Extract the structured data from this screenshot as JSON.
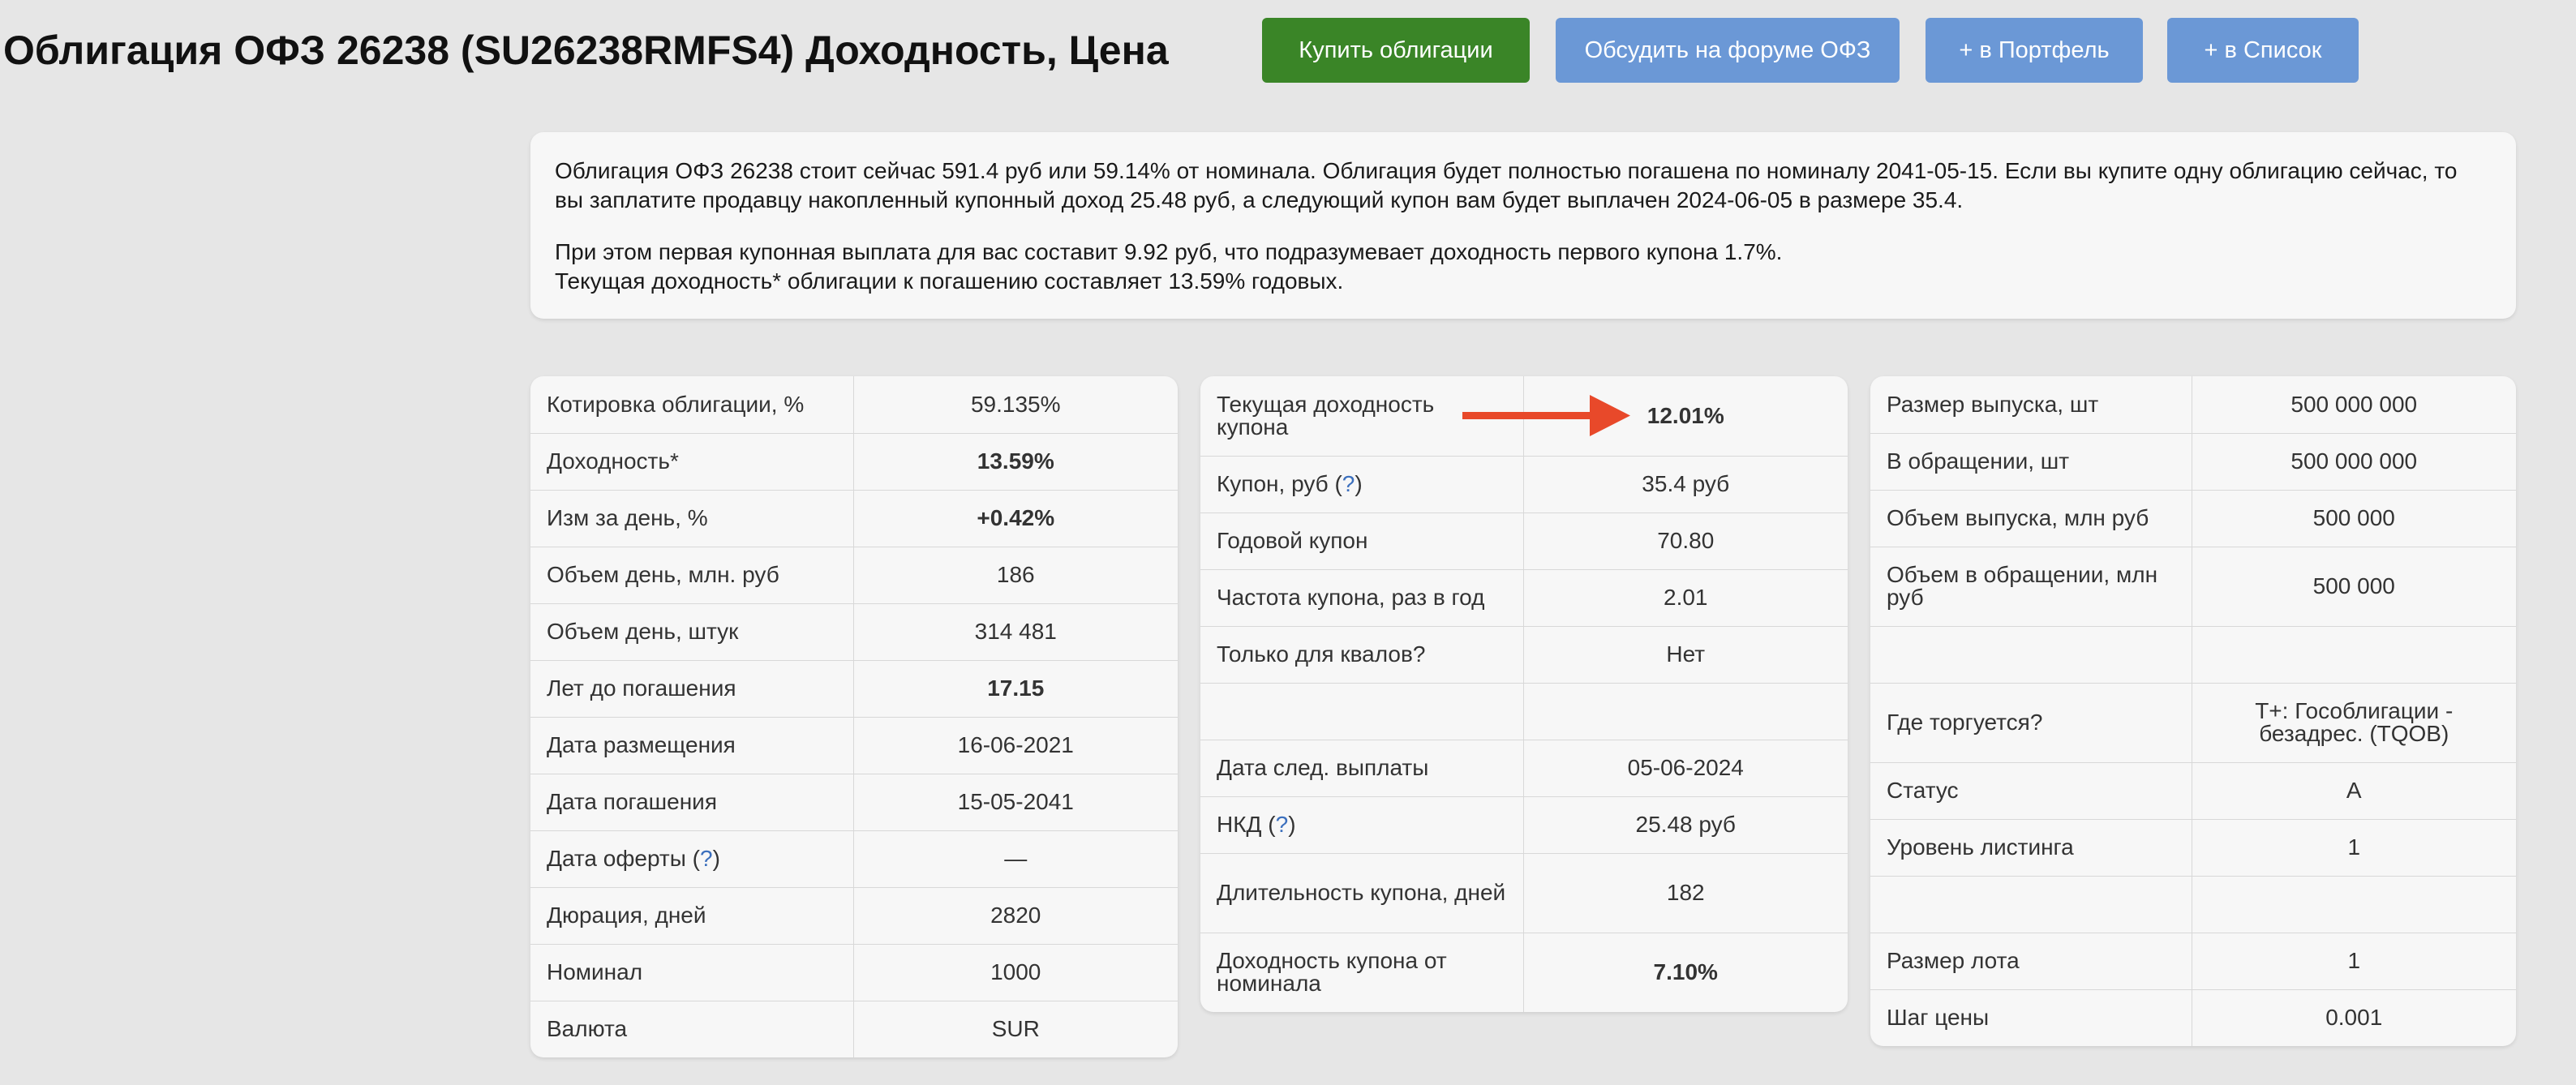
{
  "header": {
    "title": "Облигация ОФЗ 26238 (SU26238RMFS4) Доходность, Цена",
    "buttons": {
      "buy": "Купить облигации",
      "forum": "Обсудить на форуме ОФЗ",
      "portfolio": "+ в Портфель",
      "list": "+ в Список"
    }
  },
  "description": {
    "p1": "Облигация ОФЗ 26238 стоит сейчас 591.4 руб или 59.14% от номинала. Облигация будет полностью погашена по номиналу 2041-05-15. Если вы купите одну облигацию сейчас, то вы заплатите продавцу накопленный купонный доход 25.48 руб, а следующий купон вам будет выплачен 2024-06-05 в размере 35.4.",
    "p2_line1": "При этом первая купонная выплата для вас составит 9.92 руб, что подразумевает доходность первого купона 1.7%.",
    "p2_line2": "Текущая доходность* облигации к погашению составляет 13.59% годовых."
  },
  "tables": {
    "left": [
      {
        "label": "Котировка облигации, %",
        "value": "59.135%"
      },
      {
        "label": "Доходность*",
        "value": "13.59%"
      },
      {
        "label": "Изм за день, %",
        "value": "+0.42%"
      },
      {
        "label": "Объем день, млн. руб",
        "value": "186"
      },
      {
        "label": "Объем день, штук",
        "value": "314 481"
      },
      {
        "label": "Лет до погашения",
        "value": "17.15"
      },
      {
        "label": "Дата размещения",
        "value": "16-06-2021"
      },
      {
        "label": "Дата погашения",
        "value": "15-05-2041"
      },
      {
        "label": "Дата оферты (",
        "help": "?",
        "label_end": ")",
        "value": "—"
      },
      {
        "label": "Дюрация, дней",
        "value": "2820"
      },
      {
        "label": "Номинал",
        "value": "1000"
      },
      {
        "label": "Валюта",
        "value": "SUR"
      }
    ],
    "middle": [
      {
        "label": "Текущая доходность купона",
        "value": "12.01%"
      },
      {
        "label": "Купон, руб (",
        "help": "?",
        "label_end": ")",
        "value": "35.4 руб"
      },
      {
        "label": "Годовой купон",
        "value": "70.80"
      },
      {
        "label": "Частота купона, раз в год",
        "value": "2.01"
      },
      {
        "label": "Только для квалов?",
        "value": "Нет"
      },
      {
        "label": "",
        "value": ""
      },
      {
        "label": "Дата след. выплаты",
        "value": "05-06-2024"
      },
      {
        "label": "НКД (",
        "help": "?",
        "label_end": ")",
        "value": "25.48 руб"
      },
      {
        "label": "Длительность купона, дней",
        "value": "182"
      },
      {
        "label": "Доходность купона от номинала",
        "value": "7.10%"
      }
    ],
    "right": [
      {
        "label": "Размер выпуска, шт",
        "value": "500 000 000"
      },
      {
        "label": "В обращении, шт",
        "value": "500 000 000"
      },
      {
        "label": "Объем выпуска, млн руб",
        "value": "500 000"
      },
      {
        "label": "Объем в обращении, млн руб",
        "value": "500 000"
      },
      {
        "label": "",
        "value": ""
      },
      {
        "label": "Где торгуется?",
        "value": "T+: Гособлигации - безадрес. (TQOB)"
      },
      {
        "label": "Статус",
        "value": "A"
      },
      {
        "label": "Уровень листинга",
        "value": "1"
      },
      {
        "label": "",
        "value": ""
      },
      {
        "label": "Размер лота",
        "value": "1"
      },
      {
        "label": "Шаг цены",
        "value": "0.001"
      }
    ]
  },
  "colors": {
    "background": "#e6e6e6",
    "buy_button": "#3a8527",
    "secondary_button": "#6b98d6",
    "positive_value": "#2f7d1e",
    "arrow": "#e8492a",
    "help_link": "#3b6fbd"
  },
  "icons": {
    "arrow": "right-arrow-icon"
  }
}
